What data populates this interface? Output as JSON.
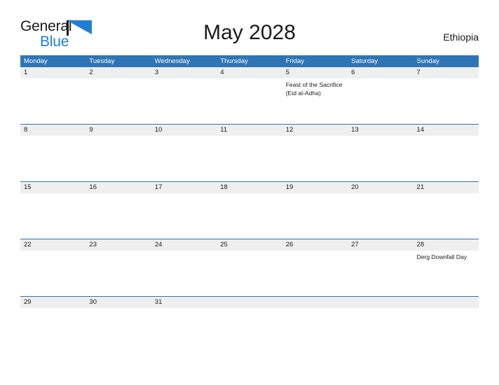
{
  "logo": {
    "word1": "General",
    "word2": "Blue",
    "flag_icon": "blue-triangle-flag-icon",
    "color_primary": "#1f7fd4",
    "color_text": "#1a1a1a"
  },
  "header": {
    "title": "May 2028",
    "country": "Ethiopia"
  },
  "theme": {
    "header_blue": "#2e75b6",
    "date_band_gray": "#efefef",
    "text": "#1a1a1a"
  },
  "calendar": {
    "weekdays": [
      "Monday",
      "Tuesday",
      "Wednesday",
      "Thursday",
      "Friday",
      "Saturday",
      "Sunday"
    ],
    "weeks": [
      [
        {
          "date": "1",
          "events": []
        },
        {
          "date": "2",
          "events": []
        },
        {
          "date": "3",
          "events": []
        },
        {
          "date": "4",
          "events": []
        },
        {
          "date": "5",
          "events": [
            "Feast of the Sacrifice (Eid al-Adha)"
          ]
        },
        {
          "date": "6",
          "events": []
        },
        {
          "date": "7",
          "events": []
        }
      ],
      [
        {
          "date": "8",
          "events": []
        },
        {
          "date": "9",
          "events": []
        },
        {
          "date": "10",
          "events": []
        },
        {
          "date": "11",
          "events": []
        },
        {
          "date": "12",
          "events": []
        },
        {
          "date": "13",
          "events": []
        },
        {
          "date": "14",
          "events": []
        }
      ],
      [
        {
          "date": "15",
          "events": []
        },
        {
          "date": "16",
          "events": []
        },
        {
          "date": "17",
          "events": []
        },
        {
          "date": "18",
          "events": []
        },
        {
          "date": "19",
          "events": []
        },
        {
          "date": "20",
          "events": []
        },
        {
          "date": "21",
          "events": []
        }
      ],
      [
        {
          "date": "22",
          "events": []
        },
        {
          "date": "23",
          "events": []
        },
        {
          "date": "24",
          "events": []
        },
        {
          "date": "25",
          "events": []
        },
        {
          "date": "26",
          "events": []
        },
        {
          "date": "27",
          "events": []
        },
        {
          "date": "28",
          "events": [
            "Derg Downfall Day"
          ]
        }
      ],
      [
        {
          "date": "29",
          "events": []
        },
        {
          "date": "30",
          "events": []
        },
        {
          "date": "31",
          "events": []
        },
        {
          "date": "",
          "events": []
        },
        {
          "date": "",
          "events": []
        },
        {
          "date": "",
          "events": []
        },
        {
          "date": "",
          "events": []
        }
      ]
    ]
  }
}
